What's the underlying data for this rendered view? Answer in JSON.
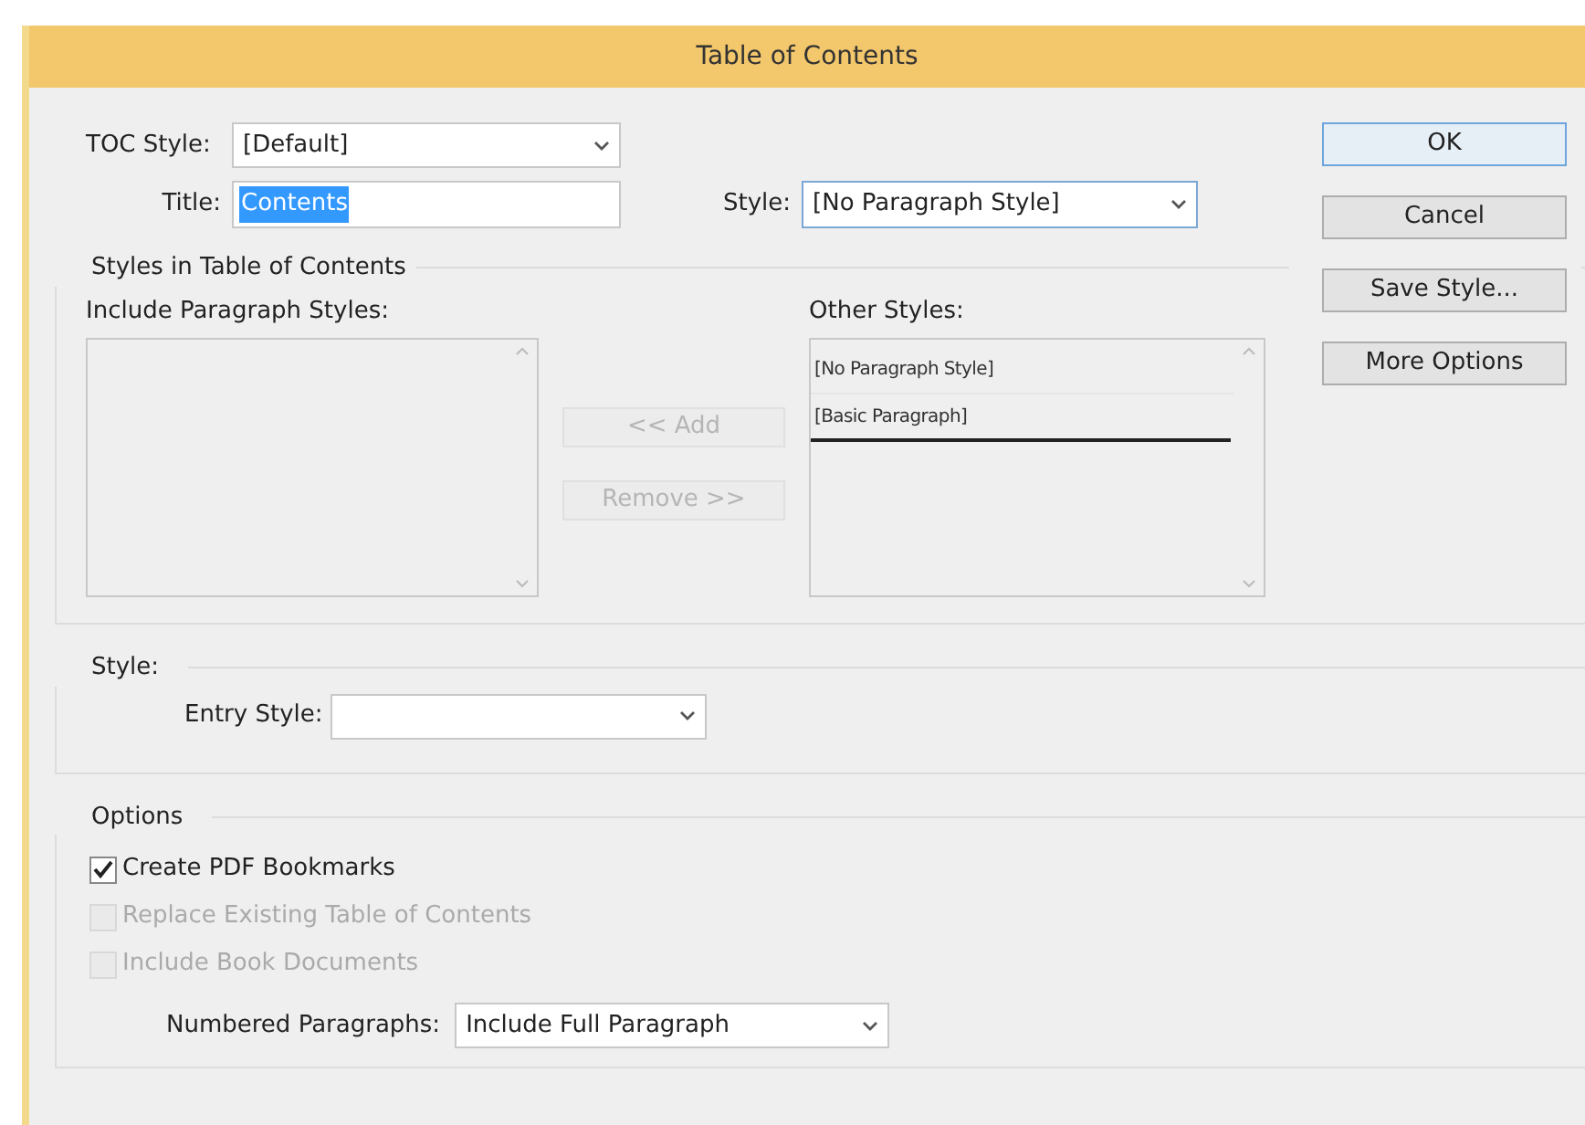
{
  "window": {
    "title": "Table of Contents"
  },
  "toc_style": {
    "label": "TOC Style:",
    "value": "[Default]"
  },
  "title_field": {
    "label": "Title:",
    "value": "Contents",
    "highlighted": true
  },
  "style_field": {
    "label": "Style:",
    "value": "[No Paragraph Style]"
  },
  "buttons": [
    {
      "label": "OK",
      "default": true
    },
    {
      "label": "Cancel",
      "default": false
    },
    {
      "label": "Save Style...",
      "default": false
    },
    {
      "label": "More Options",
      "default": false
    }
  ],
  "styles_group": {
    "title": "Styles in Table of Contents",
    "include_label": "Include Paragraph Styles:",
    "add_button": {
      "label": "<< Add",
      "disabled": true
    },
    "remove_button": {
      "label": "Remove >>",
      "disabled": true
    },
    "other_label": "Other Styles:",
    "other_items": [
      {
        "label": "[No Paragraph Style]",
        "drop_target": false
      },
      {
        "label": "[Basic Paragraph]",
        "drop_target": true
      }
    ]
  },
  "style_group": {
    "title": "Style:",
    "entry_style": {
      "label": "Entry Style:"
    }
  },
  "options": {
    "title": "Options",
    "checkboxes": [
      {
        "label": "Create PDF Bookmarks",
        "checked": true,
        "disabled": false
      },
      {
        "label": "Replace Existing Table of Contents",
        "checked": false,
        "disabled": true
      },
      {
        "label": "Include Book Documents",
        "checked": false,
        "disabled": true
      }
    ],
    "numbered": {
      "label": "Numbered Paragraphs:",
      "value": "Include Full Paragraph"
    }
  }
}
